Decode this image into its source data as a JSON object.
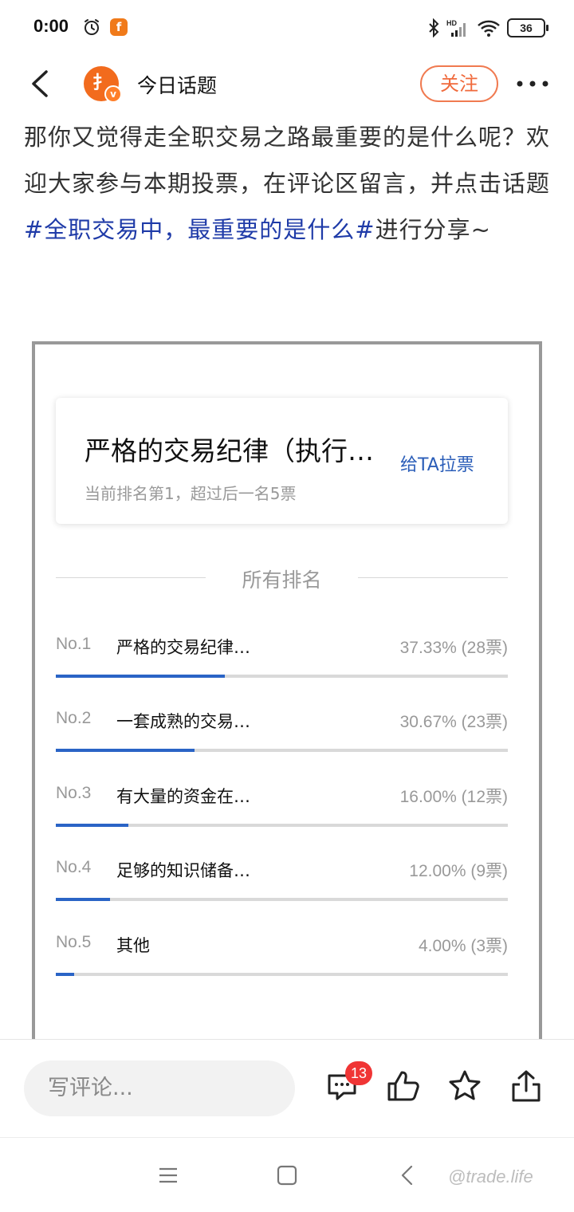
{
  "status_bar": {
    "time": "0:00",
    "app_badge": "f",
    "battery": "36",
    "icons": [
      "alarm-icon",
      "bluetooth-icon",
      "signal-icon",
      "wifi-icon",
      "battery-icon"
    ]
  },
  "nav": {
    "title": "今日话题",
    "logo_text": "扌",
    "logo_badge": "v",
    "follow_label": "关注",
    "icons": [
      "back-icon",
      "more-icon"
    ]
  },
  "article": {
    "text_before": "那你又觉得走全职交易之路最重要的是什么呢？欢迎大家参与本期投票，在评论区留言，并点击话题",
    "hashtag": "#全职交易中，最重要的是什么#",
    "text_after": "进行分享~"
  },
  "top_card": {
    "title": "严格的交易纪律（执行…",
    "subtitle": "当前排名第1，超过后一名5票",
    "vote_label": "给TA拉票"
  },
  "ranking": {
    "header": "所有排名",
    "accent_color": "#2a64c6",
    "items": [
      {
        "no": "No.1",
        "name": "严格的交易纪律…",
        "value": "37.33% (28票)",
        "percent": 37.33
      },
      {
        "no": "No.2",
        "name": "一套成熟的交易…",
        "value": "30.67% (23票)",
        "percent": 30.67
      },
      {
        "no": "No.3",
        "name": "有大量的资金在…",
        "value": "16.00% (12票)",
        "percent": 16.0
      },
      {
        "no": "No.4",
        "name": "足够的知识储备…",
        "value": "12.00% (9票)",
        "percent": 12.0
      },
      {
        "no": "No.5",
        "name": "其他",
        "value": "4.00% (3票)",
        "percent": 4.0
      }
    ]
  },
  "action_bar": {
    "comment_placeholder": "写评论...",
    "comment_count": "13",
    "icons": [
      "comment-icon",
      "like-icon",
      "favorite-icon",
      "share-icon"
    ]
  },
  "system_nav": {
    "watermark": "@trade.life",
    "icons": [
      "menu-icon",
      "home-icon",
      "back-nav-icon"
    ]
  }
}
